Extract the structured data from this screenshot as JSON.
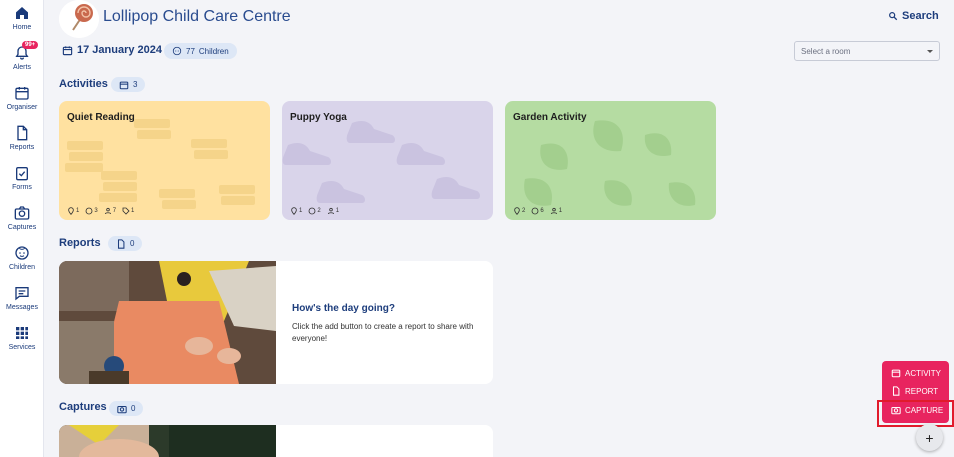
{
  "sidebar": {
    "items": [
      {
        "label": "Home",
        "icon": "home-icon"
      },
      {
        "label": "Alerts",
        "icon": "bell-icon",
        "badge": "99+"
      },
      {
        "label": "Organiser",
        "icon": "calendar-icon"
      },
      {
        "label": "Reports",
        "icon": "document-icon"
      },
      {
        "label": "Forms",
        "icon": "clipboard-check-icon"
      },
      {
        "label": "Captures",
        "icon": "camera-icon"
      },
      {
        "label": "Children",
        "icon": "child-face-icon"
      },
      {
        "label": "Messages",
        "icon": "message-icon"
      },
      {
        "label": "Services",
        "icon": "grid-icon"
      }
    ]
  },
  "header": {
    "centre_name": "Lollipop Child Care Centre",
    "search_label": "Search",
    "date": "17 January 2024",
    "children_count": "77",
    "children_label": "Children",
    "room_placeholder": "Select a room"
  },
  "activities": {
    "title": "Activities",
    "count": "3",
    "cards": [
      {
        "title": "Quiet Reading",
        "color": "#ffe1a0",
        "pattern": "#f5d48a",
        "meta": [
          "1",
          "3",
          "7",
          "1"
        ]
      },
      {
        "title": "Puppy Yoga",
        "color": "#d9d4ea",
        "pattern": "#cac3e0",
        "meta": [
          "1",
          "2",
          "1"
        ]
      },
      {
        "title": "Garden Activity",
        "color": "#b5dca2",
        "pattern": "#a3cf8e",
        "meta": [
          "2",
          "6",
          "1"
        ]
      }
    ]
  },
  "reports": {
    "title": "Reports",
    "count": "0",
    "heading": "How's the day going?",
    "text": "Click the add button to create a report to share with everyone!"
  },
  "captures": {
    "title": "Captures",
    "count": "0"
  },
  "fab": {
    "items": [
      {
        "label": "ACTIVITY",
        "icon": "calendar-icon"
      },
      {
        "label": "REPORT",
        "icon": "document-icon"
      },
      {
        "label": "CAPTURE",
        "icon": "camera-icon"
      }
    ],
    "add_symbol": "+",
    "accent": "#e8245f"
  },
  "colors": {
    "primary": "#1d3d7c",
    "badge": "#e8245f",
    "chip": "#dde7f6"
  }
}
